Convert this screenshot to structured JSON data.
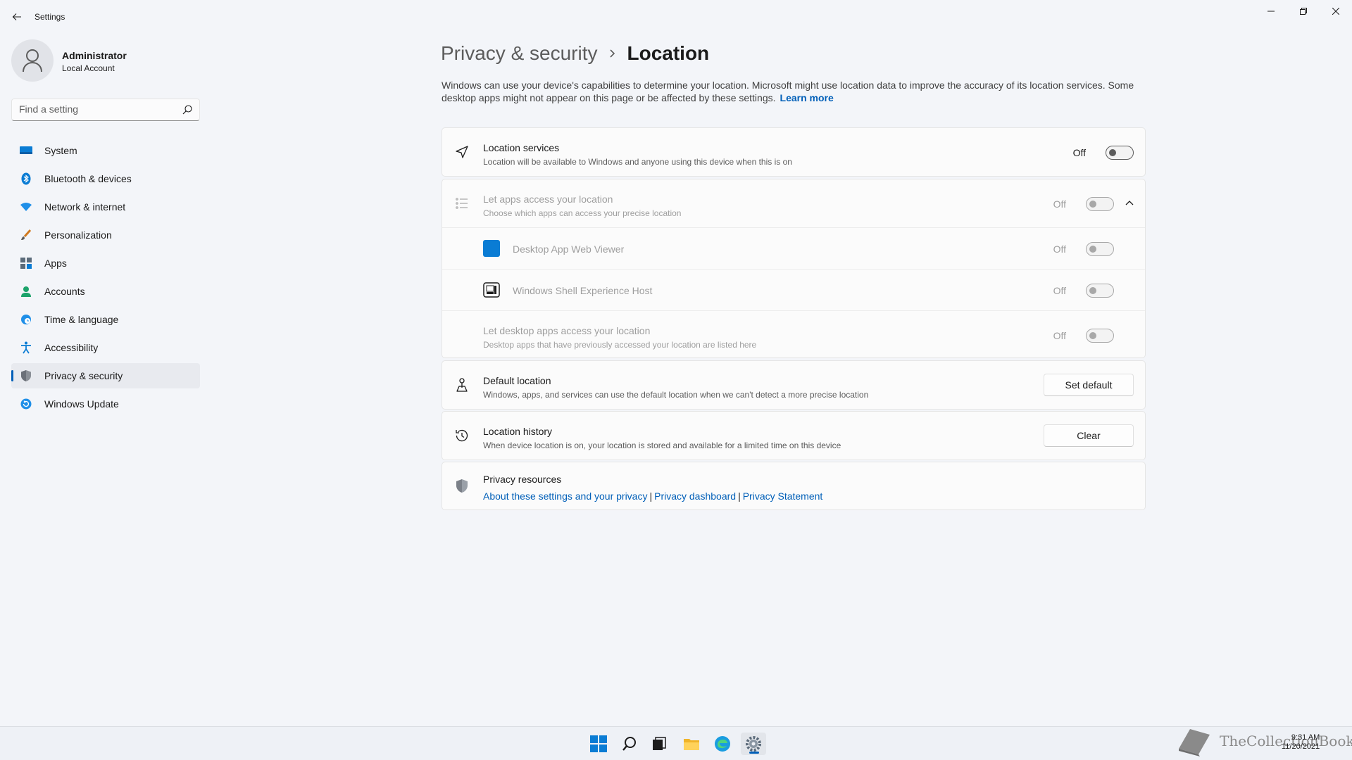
{
  "window": {
    "title": "Settings"
  },
  "profile": {
    "name": "Administrator",
    "account_type": "Local Account"
  },
  "search": {
    "placeholder": "Find a setting"
  },
  "sidebar": {
    "items": [
      {
        "label": "System",
        "icon": "system-icon"
      },
      {
        "label": "Bluetooth & devices",
        "icon": "bluetooth-icon"
      },
      {
        "label": "Network & internet",
        "icon": "network-icon"
      },
      {
        "label": "Personalization",
        "icon": "brush-icon"
      },
      {
        "label": "Apps",
        "icon": "apps-icon"
      },
      {
        "label": "Accounts",
        "icon": "accounts-icon"
      },
      {
        "label": "Time & language",
        "icon": "globe-clock-icon"
      },
      {
        "label": "Accessibility",
        "icon": "accessibility-icon"
      },
      {
        "label": "Privacy & security",
        "icon": "shield-icon",
        "active": true
      },
      {
        "label": "Windows Update",
        "icon": "update-icon"
      }
    ]
  },
  "breadcrumb": {
    "parent": "Privacy & security",
    "current": "Location"
  },
  "intro": {
    "text": "Windows can use your device's capabilities to determine your location. Microsoft might use location data to improve the accuracy of its location services. Some desktop apps might not appear on this page or be affected by these settings.",
    "link": "Learn more"
  },
  "location_services": {
    "title": "Location services",
    "description": "Location will be available to Windows and anyone using this device when this is on",
    "state": "Off"
  },
  "app_access": {
    "title": "Let apps access your location",
    "description": "Choose which apps can access your precise location",
    "state": "Off",
    "apps": [
      {
        "name": "Desktop App Web Viewer",
        "state": "Off"
      },
      {
        "name": "Windows Shell Experience Host",
        "state": "Off"
      }
    ],
    "desktop": {
      "title": "Let desktop apps access your location",
      "description": "Desktop apps that have previously accessed your location are listed here",
      "state": "Off"
    }
  },
  "default_location": {
    "title": "Default location",
    "description": "Windows, apps, and services can use the default location when we can't detect a more precise location",
    "button": "Set default"
  },
  "location_history": {
    "title": "Location history",
    "description": "When device location is on, your location is stored and available for a limited time on this device",
    "button": "Clear"
  },
  "privacy_resources": {
    "title": "Privacy resources",
    "links": [
      "About these settings and your privacy",
      "Privacy dashboard",
      "Privacy Statement"
    ],
    "separator": "|"
  },
  "taskbar": {
    "clock": {
      "time": "9:31 AM",
      "date": "11/20/2021"
    },
    "watermark": "TheCollectionBook"
  },
  "colors": {
    "accent": "#005fb8"
  }
}
